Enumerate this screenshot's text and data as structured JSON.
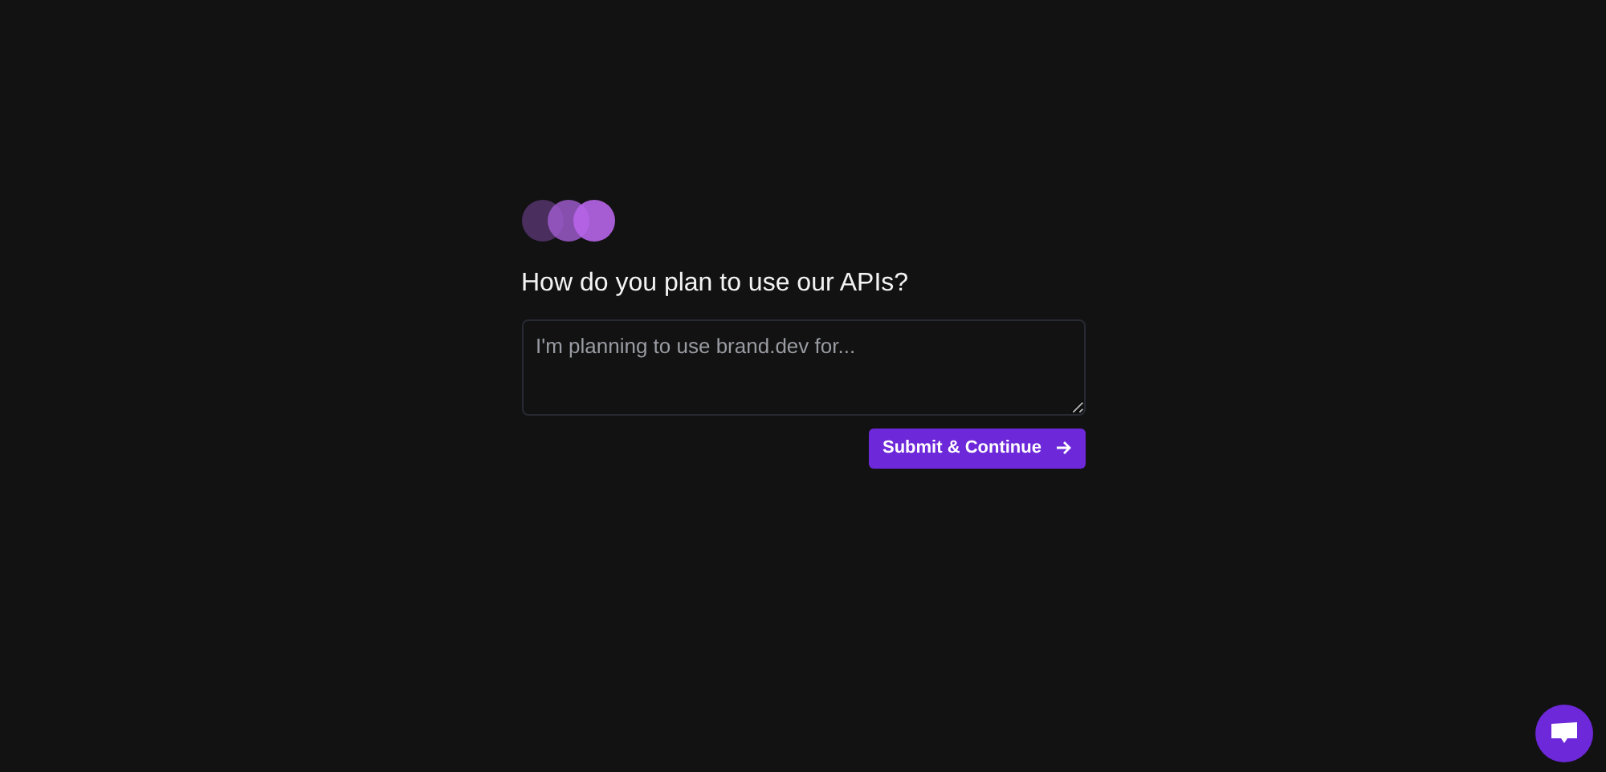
{
  "question": "How do you plan to use our APIs?",
  "answer": {
    "placeholder": "I'm planning to use brand.dev for..."
  },
  "submit_button": {
    "label": "Submit & Continue"
  }
}
